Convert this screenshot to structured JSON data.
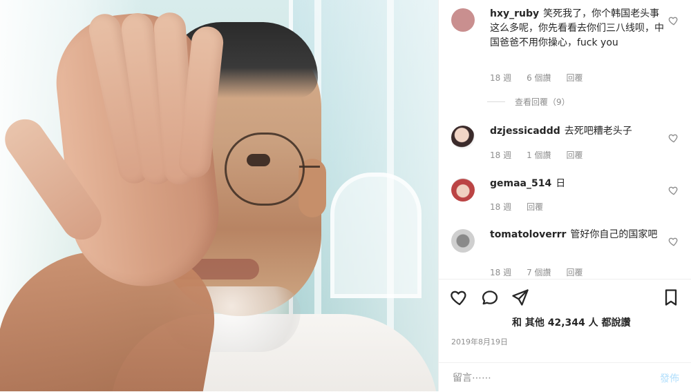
{
  "comments": [
    {
      "username": "hxy_ruby",
      "text": "笑死我了，你个韩国老头事这么多呢，你先看看去你们三八线呗，中国爸爸不用你操心，fuck you",
      "time": "18 週",
      "likes": "6 個讚",
      "reply": "回覆"
    },
    {
      "username": "dzjessicaddd",
      "text": "去死吧糟老头子",
      "time": "18 週",
      "likes": "1 個讚",
      "reply": "回覆"
    },
    {
      "username": "gemaa_514",
      "text": "日",
      "time": "18 週",
      "reply": "回覆"
    },
    {
      "username": "tomatoloverrr",
      "text": "管好你自己的国家吧",
      "time": "18 週",
      "likes": "7 個讚",
      "reply": "回覆"
    }
  ],
  "view_replies": "查看回覆（9）",
  "likes_summary": {
    "prefix": "和 其他",
    "count": "42,344",
    "suffix": "人 都說讚"
  },
  "date": "2019年8月19日",
  "compose": {
    "placeholder": "留言⋯⋯",
    "post_label": "發佈"
  },
  "icons": {
    "like": "heart-icon",
    "comment": "comment-icon",
    "share": "send-icon",
    "save": "bookmark-icon"
  }
}
